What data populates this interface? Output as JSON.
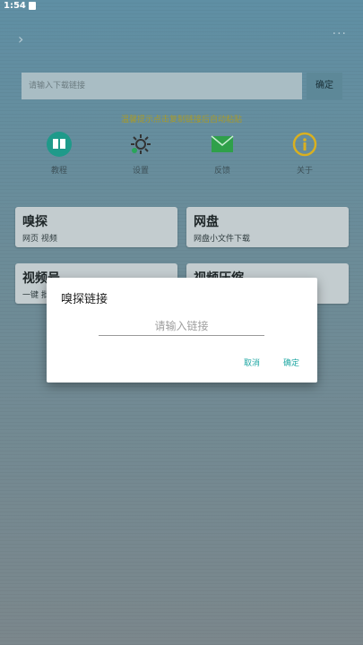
{
  "statusbar": {
    "time": "1:54"
  },
  "search": {
    "placeholder": "请输入下载链接",
    "confirm_label": "确定"
  },
  "notice": "温馨提示点击复制链接后自动粘贴",
  "quick_actions": [
    {
      "label": "教程",
      "icon": "book-icon",
      "color": "#1f9a8a"
    },
    {
      "label": "设置",
      "icon": "gear-icon",
      "color": "#333333"
    },
    {
      "label": "反馈",
      "icon": "mail-icon",
      "color": "#2fa04a"
    },
    {
      "label": "关于",
      "icon": "info-icon",
      "color": "#d9b020"
    }
  ],
  "cards": [
    {
      "title": "嗅探",
      "subtitle": "网页 视频"
    },
    {
      "title": "网盘",
      "subtitle": "网盘小文件下载"
    },
    {
      "title": "视频号",
      "subtitle": "一键 批"
    },
    {
      "title": "视频压缩",
      "subtitle": ""
    }
  ],
  "dialog": {
    "title": "嗅探链接",
    "input_placeholder": "请输入链接",
    "cancel_label": "取消",
    "ok_label": "确定"
  }
}
